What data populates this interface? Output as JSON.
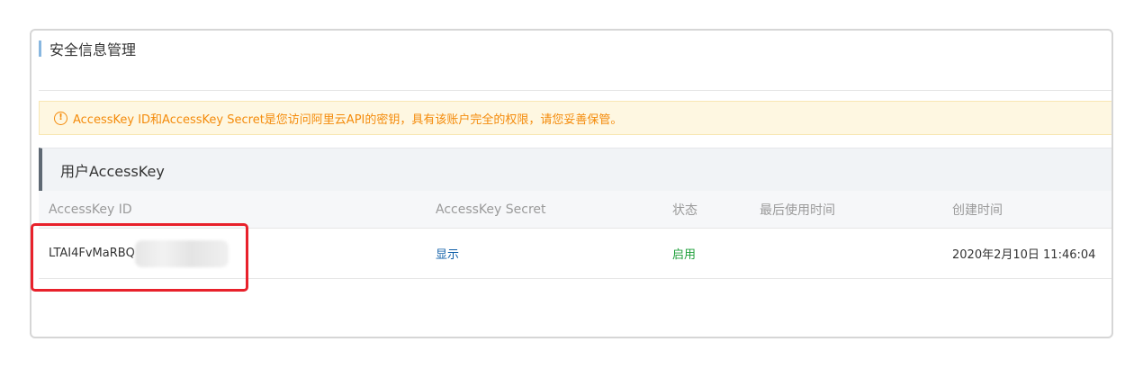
{
  "panel": {
    "title": "安全信息管理"
  },
  "notice": {
    "icon": "warning-circle-icon",
    "text": "AccessKey ID和AccessKey Secret是您访问阿里云API的密钥，具有该账户完全的权限，请您妥善保管。"
  },
  "section": {
    "title": "用户AccessKey"
  },
  "table": {
    "columns": [
      "AccessKey ID",
      "AccessKey Secret",
      "状态",
      "最后使用时间",
      "创建时间"
    ],
    "rows": [
      {
        "access_key_id": "LTAI4FvMaRBQ",
        "access_key_secret_action": "显示",
        "status": "启用",
        "last_used": "",
        "created": "2020年2月10日 11:46:04"
      }
    ]
  },
  "colors": {
    "notice_text": "#f48b0b",
    "link": "#0f5fa8",
    "status_enabled": "#1e9f3a",
    "highlight_box": "#e8212b"
  }
}
